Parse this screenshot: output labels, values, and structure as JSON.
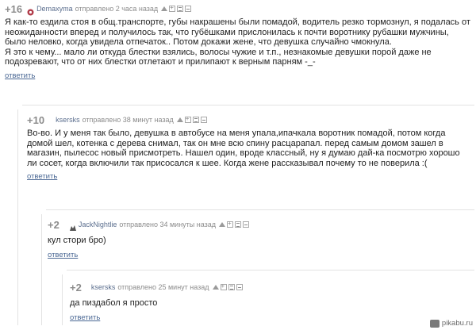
{
  "comments": [
    {
      "rating": "+16",
      "user": "Demaxyma",
      "meta": "отправлено 2 часа назад",
      "text": "Я как-то ездила стоя в общ.транспорте, губы накрашены были помадой, водитель резко тормознул, я подалась от неожиданности вперед и получилось так, что губёшками прислонилась к почти воротнику рубашки мужчины, было неловко, когда увидела отпечаток.. Потом докажи жене, что девушка случайно чмокнула.",
      "text2": "Я это к чему... мало ли откуда блестки взялись, волосы чужие и т.п., незнакомые девушки порой даже не подозревают, что от них блестки отлетают и прилипают к верным парням -_-",
      "reply_label": "ответить"
    },
    {
      "rating": "+10",
      "user": "ksersks",
      "meta": "отправлено 38 минут назад",
      "text": "Во-во. И у меня так было, девушка в автобусе на меня упала,ипачкала воротник помадой, потом когда домой шел, котенка с дерева снимал, так он мне всю спину расцарапал. перед самым домом зашел в магазин, пылесос новый присмотреть. Нашел один, вроде классный, ну я думаю дай-ка посмотрю хорошо ли сосет, когда включили так присосался к шее. Когда жене рассказывал почему то не поверила :(",
      "reply_label": "ответить"
    },
    {
      "rating": "+2",
      "user": "JackNightlie",
      "meta": "отправлено 34 минуты назад",
      "text": "кул стори бро)",
      "reply_label": "ответить"
    },
    {
      "rating": "+2",
      "user": "ksersks",
      "meta": "отправлено 25 минут назад",
      "text": "да пиздабол я просто",
      "reply_label": "ответить"
    }
  ],
  "watermark": "pikabu.ru",
  "colors": {
    "link": "#4c6995",
    "rating": "#8c8c8c",
    "divider": "#e3e3e3"
  }
}
